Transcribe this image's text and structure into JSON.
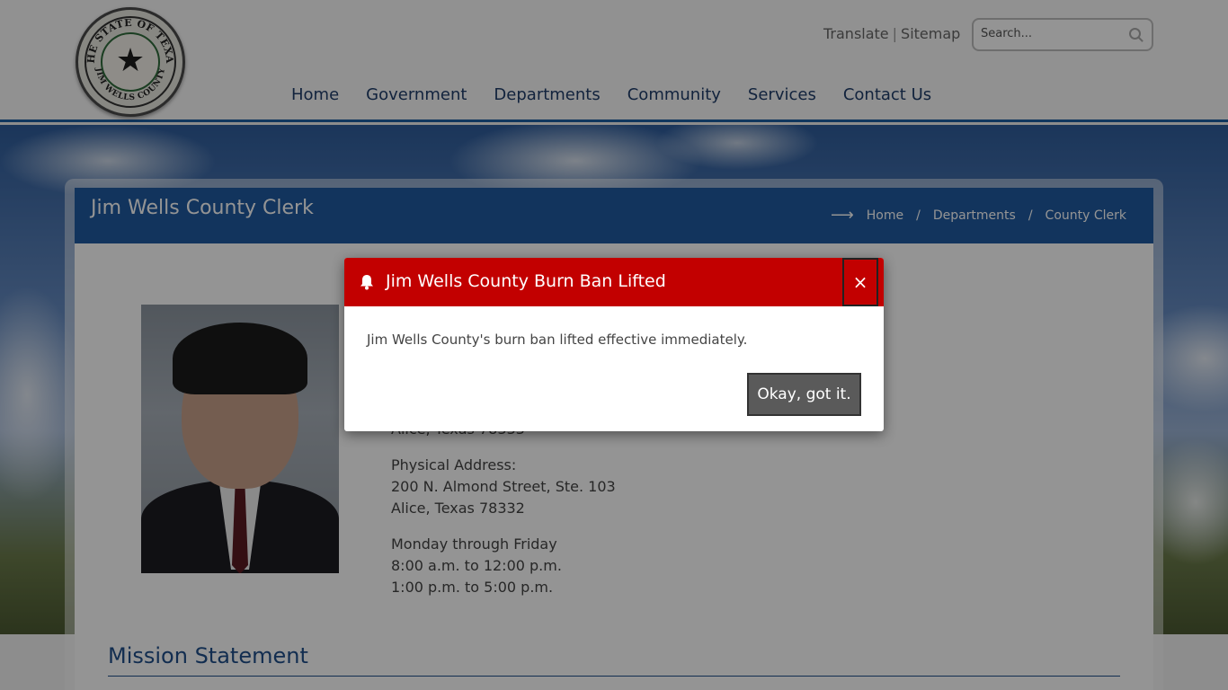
{
  "header": {
    "seal_text_top": "THE STATE OF TEXAS",
    "seal_text_bottom": "JIM WELLS COUNTY",
    "translate_label": "Translate",
    "separator": "|",
    "sitemap_label": "Sitemap",
    "search_placeholder": "Search...",
    "nav": [
      "Home",
      "Government",
      "Departments",
      "Community",
      "Services",
      "Contact Us"
    ]
  },
  "page": {
    "title": "Jim Wells County Clerk",
    "breadcrumb": [
      "Home",
      "Departments",
      "County Clerk"
    ],
    "breadcrumb_sep": "/",
    "partial_address_line": "Alice, Texas 78333",
    "physical_address": {
      "label": "Physical Address:",
      "line1": "200 N. Almond Street, Ste. 103",
      "line2": "Alice, Texas 78332"
    },
    "hours": {
      "days": "Monday through Friday",
      "morning": "8:00 a.m. to 12:00 p.m.",
      "afternoon": "1:00 p.m. to 5:00 p.m."
    },
    "mission_heading": "Mission Statement"
  },
  "modal": {
    "title": "Jim Wells County Burn Ban Lifted",
    "close_glyph": "×",
    "message": "Jim Wells County's burn ban lifted effective immediately.",
    "ok_label": "Okay, got it."
  },
  "colors": {
    "header_blue": "#1f5aa1",
    "alert_red": "#c20000",
    "nav_text": "#1f3d6a",
    "button_gray": "#5a5a5a"
  }
}
